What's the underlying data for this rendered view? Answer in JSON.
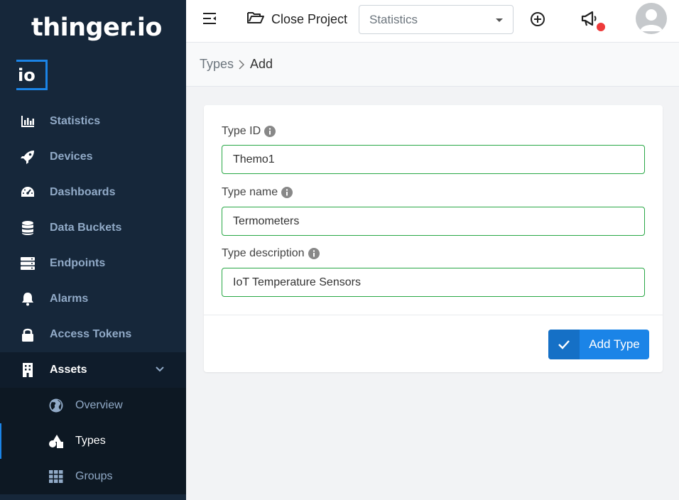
{
  "brand": {
    "name": "thinger.io",
    "mini": "io",
    "accent": "#1b84e7"
  },
  "sidebar": {
    "items": [
      {
        "label": "Statistics",
        "icon": "bar-chart-icon"
      },
      {
        "label": "Devices",
        "icon": "rocket-icon"
      },
      {
        "label": "Dashboards",
        "icon": "gauge-icon"
      },
      {
        "label": "Data Buckets",
        "icon": "database-icon"
      },
      {
        "label": "Endpoints",
        "icon": "server-icon"
      },
      {
        "label": "Alarms",
        "icon": "bell-icon"
      },
      {
        "label": "Access Tokens",
        "icon": "lock-icon"
      },
      {
        "label": "Assets",
        "icon": "building-icon",
        "expanded": true
      }
    ],
    "assets_sub": [
      {
        "label": "Overview",
        "icon": "globe-icon"
      },
      {
        "label": "Types",
        "icon": "shapes-icon",
        "active": true
      },
      {
        "label": "Groups",
        "icon": "grid-icon"
      }
    ]
  },
  "header": {
    "close_project": "Close Project",
    "project_select": "Statistics",
    "notification_color": "#ee3a3a"
  },
  "breadcrumb": {
    "parent": "Types",
    "current": "Add"
  },
  "form": {
    "type_id": {
      "label": "Type ID",
      "value": "Themo1"
    },
    "type_name": {
      "label": "Type name",
      "value": "Termometers"
    },
    "type_description": {
      "label": "Type description",
      "value": "IoT Temperature Sensors"
    },
    "submit_label": "Add Type"
  },
  "colors": {
    "sidebar_bg": "#16273a",
    "valid_border": "#28a745",
    "button": "#1b84e7"
  }
}
